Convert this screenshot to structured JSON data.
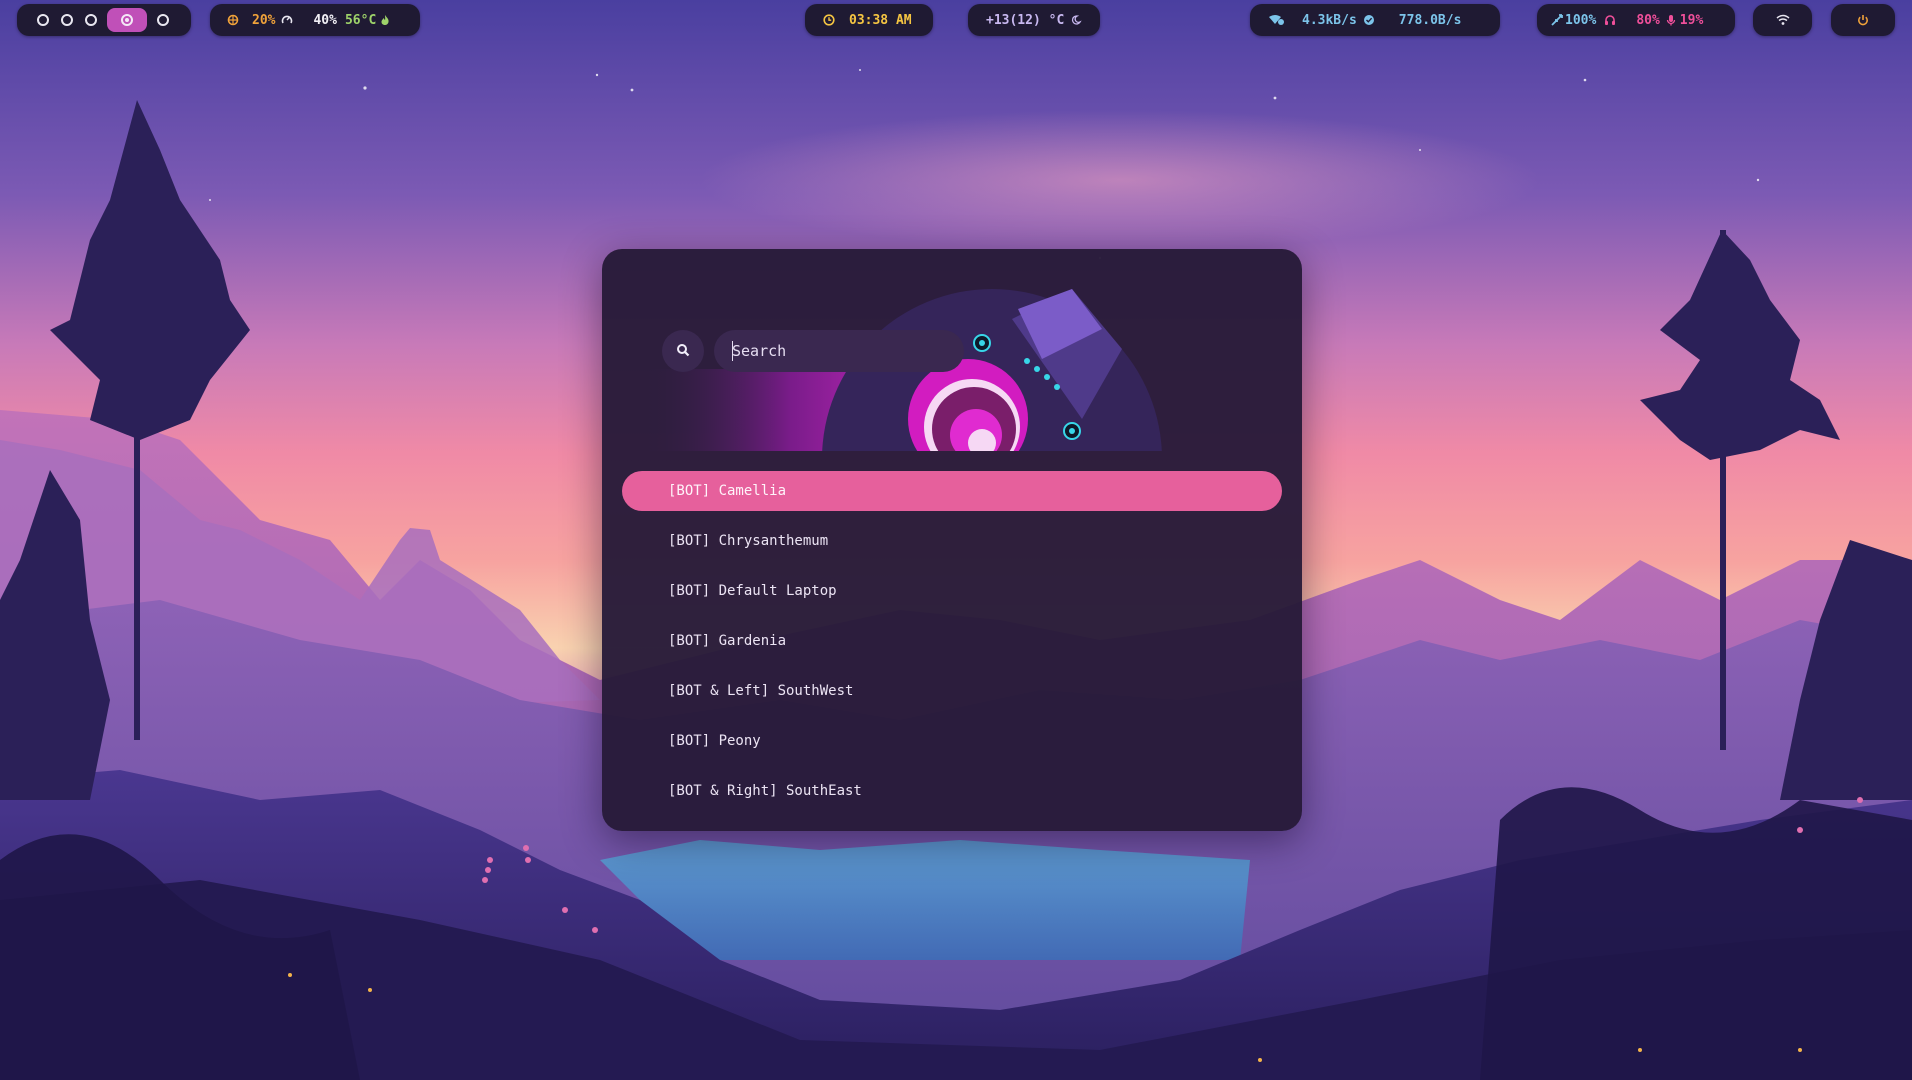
{
  "workspaces": {
    "count_before": 3,
    "count_after": 1,
    "active_index": 4
  },
  "system": {
    "cpu": "20%",
    "mem": "40%",
    "temp": "56°C"
  },
  "clock": {
    "time": "03:38 AM"
  },
  "weather": {
    "text": "+13(12) °C"
  },
  "network": {
    "down": "4.3kB/s",
    "up": "778.0B/s"
  },
  "audio": {
    "brightness": "100%",
    "volume": "80%",
    "mic": "19%"
  },
  "launcher": {
    "search_placeholder": "Search",
    "results": [
      {
        "label": "[BOT] Camellia",
        "selected": true
      },
      {
        "label": "[BOT] Chrysanthemum",
        "selected": false
      },
      {
        "label": "[BOT] Default Laptop",
        "selected": false
      },
      {
        "label": "[BOT] Gardenia",
        "selected": false
      },
      {
        "label": "[BOT & Left] SouthWest",
        "selected": false
      },
      {
        "label": "[BOT] Peony",
        "selected": false
      },
      {
        "label": "[BOT & Right] SouthEast",
        "selected": false
      }
    ]
  },
  "colors": {
    "accent": "#e6609c",
    "bar_bg": "#1f1a33",
    "panel_bg": "#261a38"
  }
}
